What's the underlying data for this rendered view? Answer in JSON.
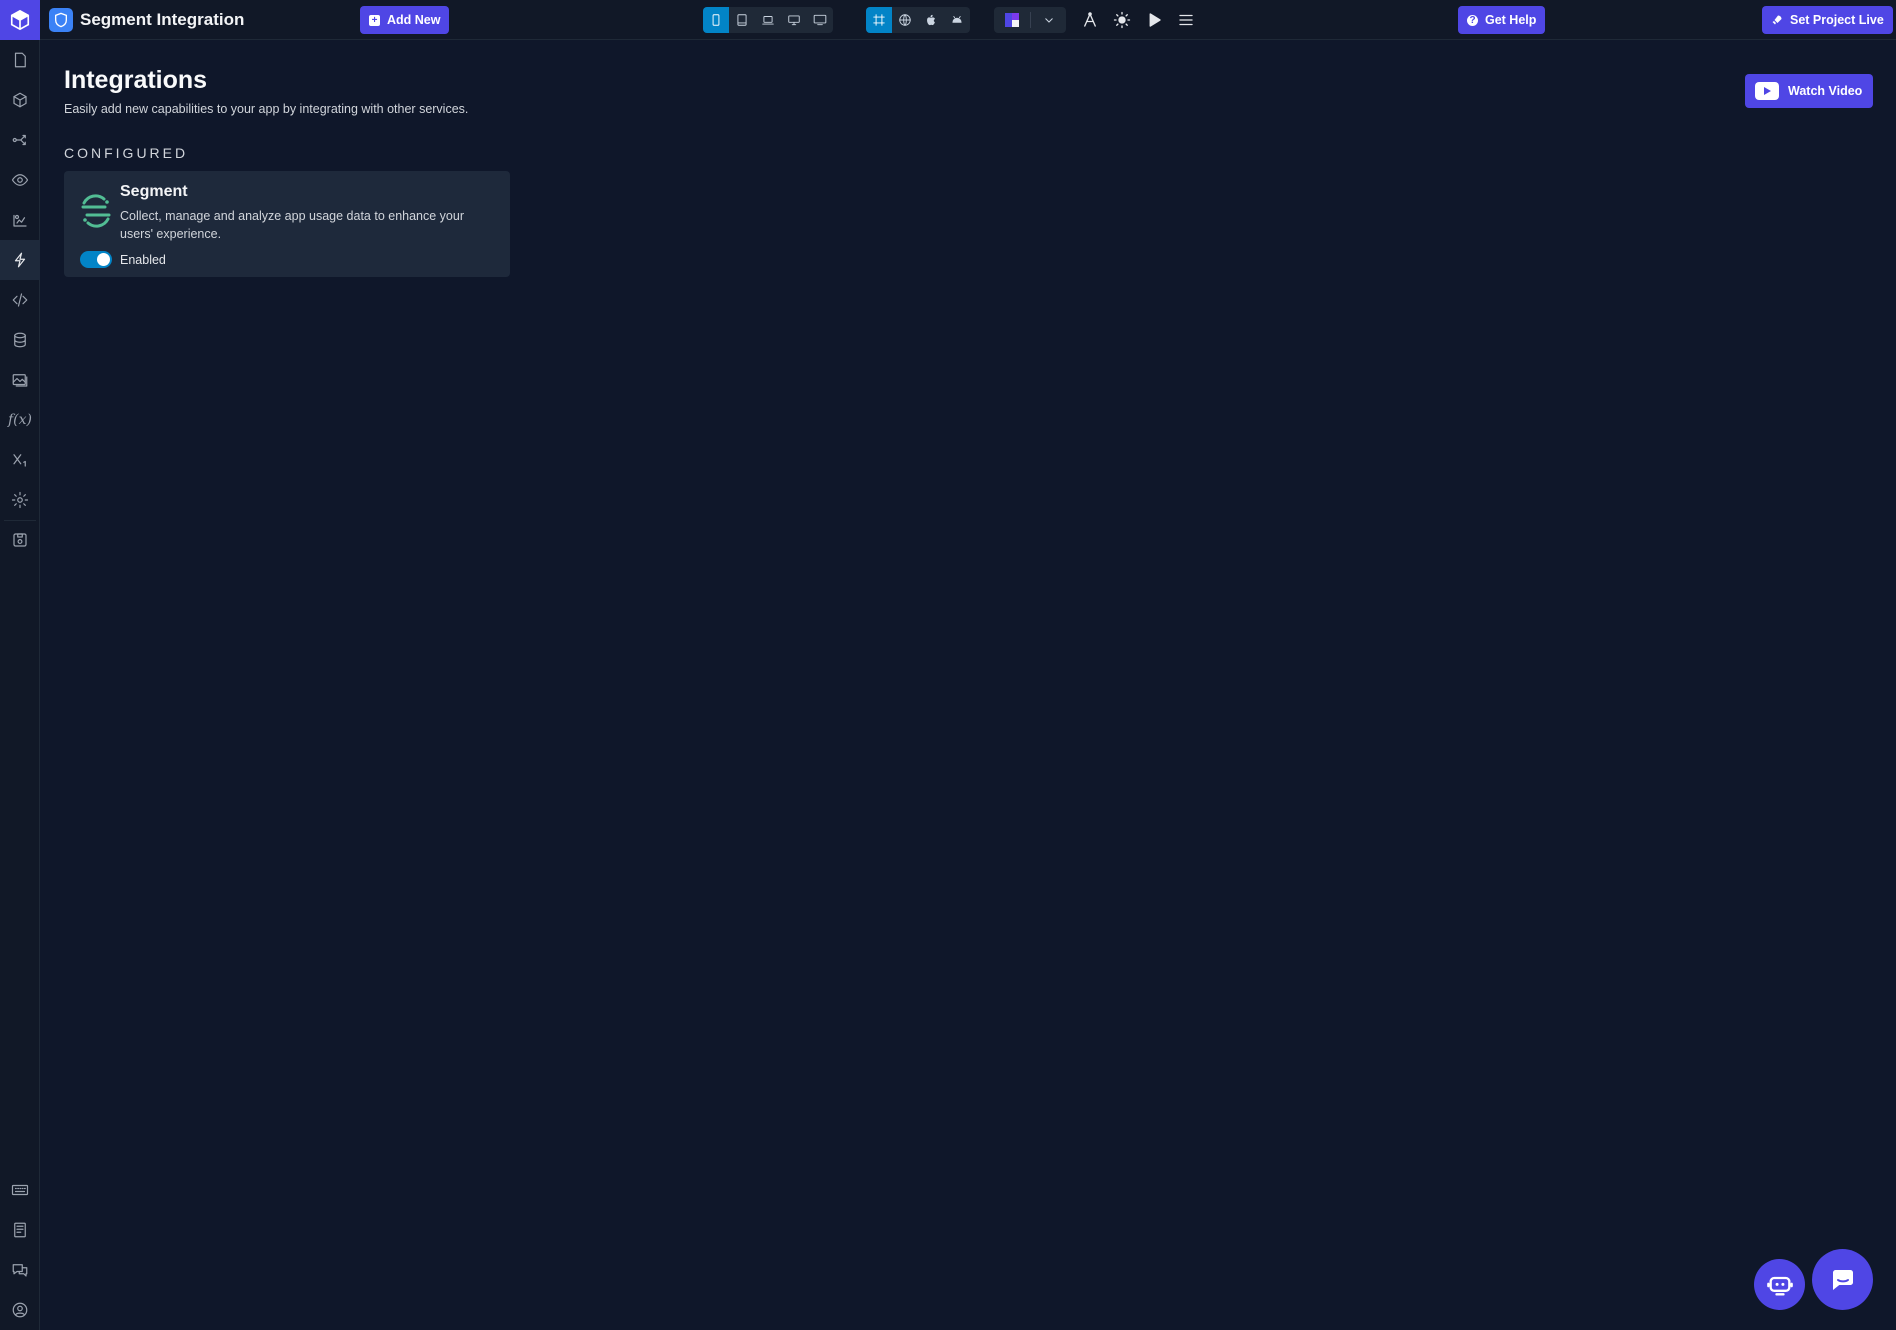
{
  "app": {
    "title": "Segment Integration",
    "add_new_label": "Add New",
    "get_help_label": "Get Help",
    "set_live_label": "Set Project Live"
  },
  "rail": {
    "items": [
      "pages-icon",
      "components-icon",
      "workflows-icon",
      "preview-icon",
      "assets-icon",
      "integrations-icon",
      "code-icon",
      "database-icon",
      "media-icon",
      "functions-icon",
      "variables-icon",
      "settings-icon",
      "save-icon"
    ],
    "bottom_items": [
      "keyboard-icon",
      "docs-icon",
      "chat-icon",
      "account-icon"
    ],
    "active": "integrations-icon"
  },
  "toolbar": {
    "devices": [
      "mobile",
      "tablet",
      "laptop",
      "desktop",
      "monitor"
    ],
    "device_selected": "mobile",
    "platforms": [
      "frame",
      "web",
      "ios",
      "android"
    ],
    "platform_selected": "frame"
  },
  "main": {
    "title": "Integrations",
    "subtitle": "Easily add new capabilities to your app by integrating with other services.",
    "watch_video_label": "Watch Video",
    "section_label": "CONFIGURED",
    "card": {
      "name": "Segment",
      "description": "Collect, manage and analyze app usage data to enhance your users' experience.",
      "toggle_label": "Enabled",
      "enabled": true
    }
  },
  "colors": {
    "accent": "#4f46e5",
    "toggle_on": "#0284c7",
    "background": "#0f172a",
    "card": "#1e293b",
    "segment_green": "#52bd94"
  }
}
